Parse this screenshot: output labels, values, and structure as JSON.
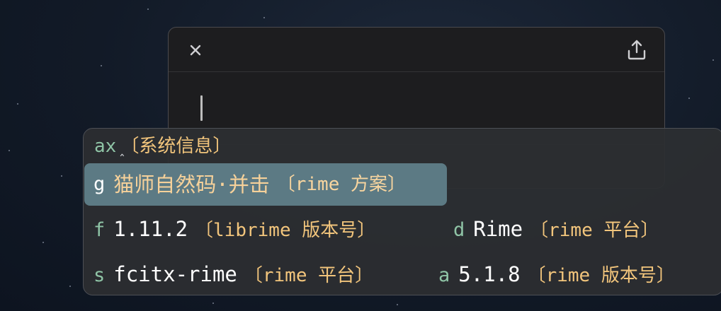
{
  "editor": {
    "close_icon": "close-icon",
    "share_icon": "share-icon"
  },
  "ime": {
    "preedit": {
      "code": "ax",
      "hint": "〔系统信息〕",
      "cursor": "ˆ"
    },
    "candidates": [
      {
        "label": "g",
        "text": "猫师自然码·并击",
        "comment": "〔rime 方案〕",
        "highlighted": true
      },
      {
        "label": "f",
        "text": "1.11.2",
        "comment": "〔librime 版本号〕"
      },
      {
        "label": "d",
        "text": "Rime",
        "comment": "〔rime 平台〕"
      },
      {
        "label": "s",
        "text": "fcitx-rime",
        "comment": "〔rime 平台〕"
      },
      {
        "label": "a",
        "text": "5.1.8",
        "comment": "〔rime 版本号〕"
      }
    ],
    "colors": {
      "label": "#8fc4a6",
      "comment": "#f2c57c",
      "highlight_bg": "#5c7a84",
      "highlight_text": "#f6d19a"
    }
  }
}
